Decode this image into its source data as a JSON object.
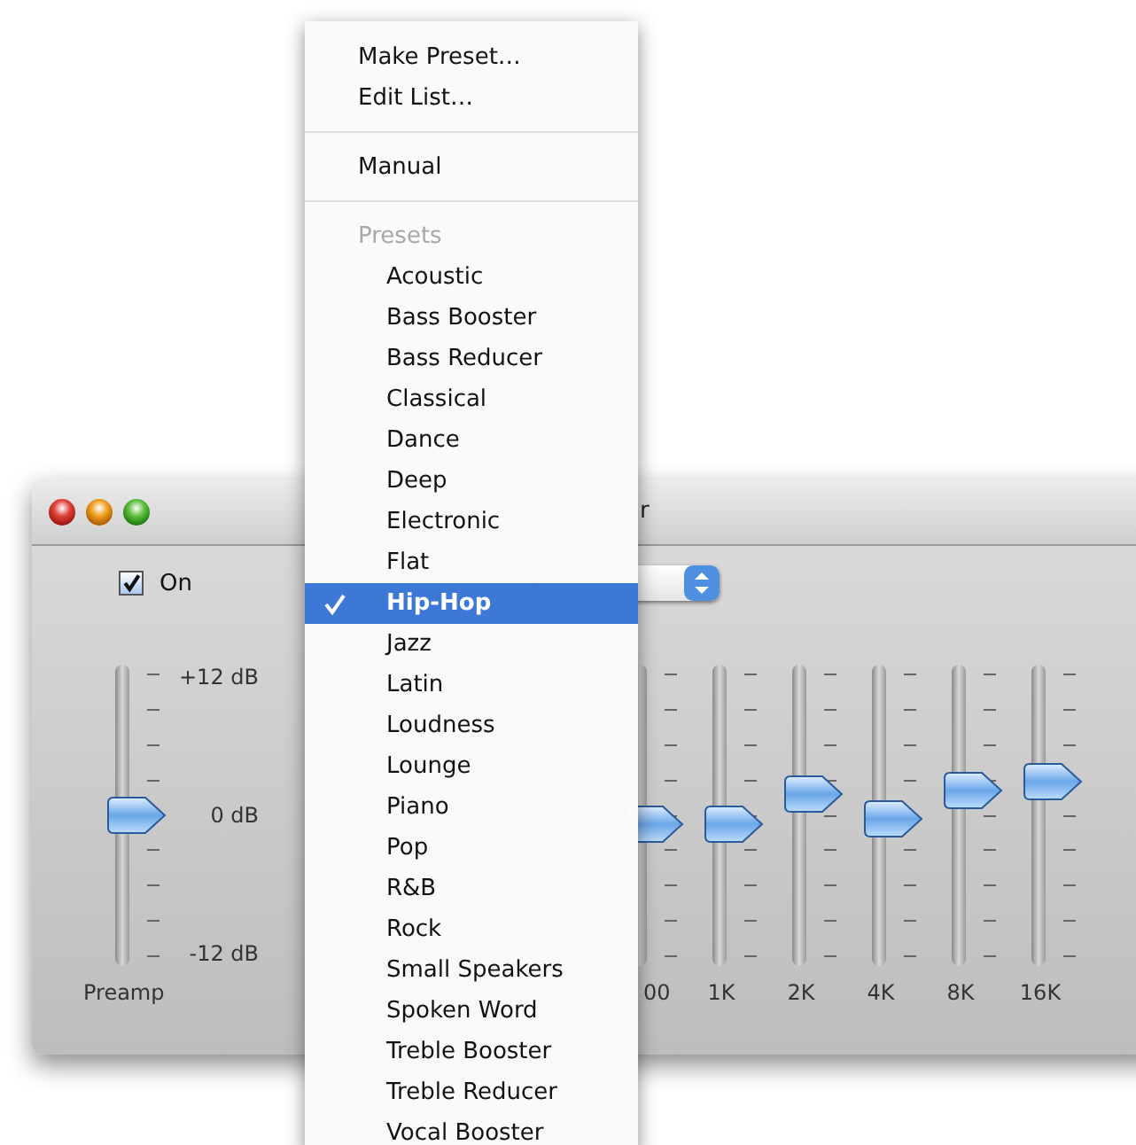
{
  "window": {
    "title": "r",
    "on_checkbox": {
      "label": "On",
      "checked": true
    },
    "preamp": {
      "label": "Preamp",
      "level": 0.5,
      "scale": [
        "+12 dB",
        "0 dB",
        "-12 dB"
      ]
    },
    "bands": [
      {
        "label": "00",
        "level": 0.47
      },
      {
        "label": "1K",
        "level": 0.47
      },
      {
        "label": "2K",
        "level": 0.57
      },
      {
        "label": "4K",
        "level": 0.49
      },
      {
        "label": "8K",
        "level": 0.58
      },
      {
        "label": "16K",
        "level": 0.61
      }
    ]
  },
  "menu": {
    "items": [
      {
        "kind": "command",
        "label": "Make Preset…"
      },
      {
        "kind": "command",
        "label": "Edit List…"
      },
      {
        "kind": "separator"
      },
      {
        "kind": "choice",
        "label": "Manual",
        "selected": false
      },
      {
        "kind": "separator"
      },
      {
        "kind": "header",
        "label": "Presets"
      },
      {
        "kind": "preset",
        "label": "Acoustic",
        "selected": false
      },
      {
        "kind": "preset",
        "label": "Bass Booster",
        "selected": false
      },
      {
        "kind": "preset",
        "label": "Bass Reducer",
        "selected": false
      },
      {
        "kind": "preset",
        "label": "Classical",
        "selected": false
      },
      {
        "kind": "preset",
        "label": "Dance",
        "selected": false
      },
      {
        "kind": "preset",
        "label": "Deep",
        "selected": false
      },
      {
        "kind": "preset",
        "label": "Electronic",
        "selected": false
      },
      {
        "kind": "preset",
        "label": "Flat",
        "selected": false
      },
      {
        "kind": "preset",
        "label": "Hip-Hop",
        "selected": true
      },
      {
        "kind": "preset",
        "label": "Jazz",
        "selected": false
      },
      {
        "kind": "preset",
        "label": "Latin",
        "selected": false
      },
      {
        "kind": "preset",
        "label": "Loudness",
        "selected": false
      },
      {
        "kind": "preset",
        "label": "Lounge",
        "selected": false
      },
      {
        "kind": "preset",
        "label": "Piano",
        "selected": false
      },
      {
        "kind": "preset",
        "label": "Pop",
        "selected": false
      },
      {
        "kind": "preset",
        "label": "R&B",
        "selected": false
      },
      {
        "kind": "preset",
        "label": "Rock",
        "selected": false
      },
      {
        "kind": "preset",
        "label": "Small Speakers",
        "selected": false
      },
      {
        "kind": "preset",
        "label": "Spoken Word",
        "selected": false
      },
      {
        "kind": "preset",
        "label": "Treble Booster",
        "selected": false
      },
      {
        "kind": "preset",
        "label": "Treble Reducer",
        "selected": false
      },
      {
        "kind": "preset",
        "label": "Vocal Booster",
        "selected": false
      }
    ]
  }
}
